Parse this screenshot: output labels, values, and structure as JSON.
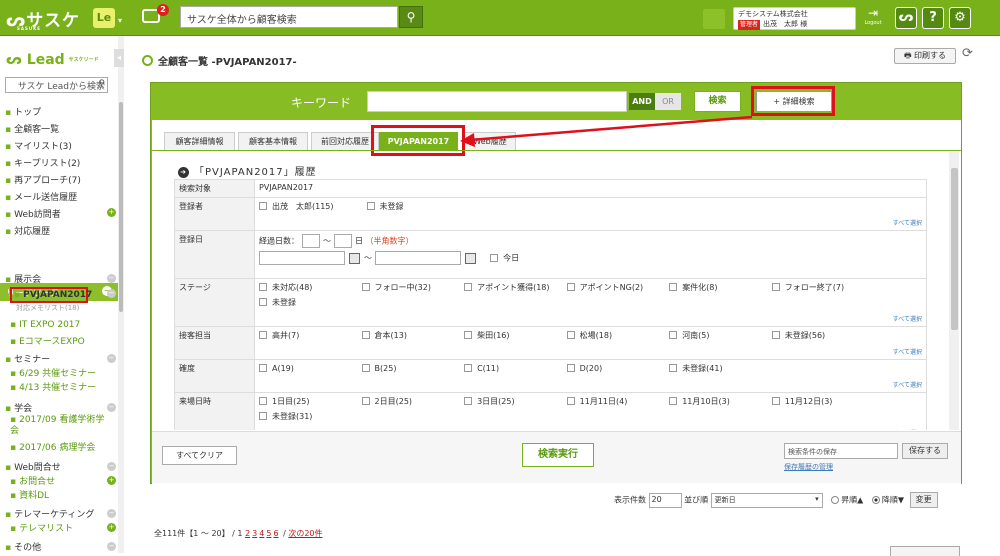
{
  "header": {
    "logo": "ᔕサスケ",
    "logo_sub": "SASUKE",
    "le": "Le",
    "notification_count": "2",
    "search_placeholder": "サスケ全体から顧客検索",
    "company": "デモシステム株式会社",
    "role": "管理者",
    "user": "出茂　太郎 様",
    "logout": "Logout"
  },
  "sidebar": {
    "logo": "ᔕ Lead",
    "logo_sub": "サスケリード",
    "search_placeholder": "サスケ Leadから検索",
    "nav": [
      "トップ",
      "全顧客一覧",
      "マイリスト(3)",
      "キープリスト(2)",
      "再アプローチ(7)",
      "メール送信履歴",
      "Web訪問者",
      "対応履歴"
    ],
    "section_title": "リードソース",
    "sources": {
      "exhibition": "展示会",
      "pvjapan": "PVJAPAN2017",
      "pv_sub": "対応メモリスト(18)",
      "itexpo": "IT EXPO 2017",
      "ecom": "EコマースEXPO",
      "seminar": "セミナー",
      "sem1": "6/29 共催セミナー",
      "sem2": "4/13 共催セミナー",
      "academic": "学会",
      "ac1": "2017/09 看護学術学会",
      "ac2": "2017/06 病理学会",
      "web": "Web問合せ",
      "web1": "お問合せ",
      "web2": "資料DL",
      "tele": "テレマーケティング",
      "tele1": "テレマリスト",
      "other": "その他"
    }
  },
  "page": {
    "title": "全顧客一覧 -PVJAPAN2017-",
    "print": "印刷する"
  },
  "search": {
    "keyword_label": "キーワード",
    "and": "AND",
    "or": "OR",
    "search_btn": "検索",
    "detail_btn": "+ 詳細検索"
  },
  "tabs": [
    "顧客詳細情報",
    "顧客基本情報",
    "前回対応履歴",
    "PVJAPAN2017",
    "Web履歴"
  ],
  "history_title": "「PVJAPAN2017」履歴",
  "filter": {
    "target_label": "検索対象",
    "target_value": "PVJAPAN2017",
    "registrant_label": "登録者",
    "registrant_opts": [
      "出茂　太郎(115)",
      "未登録"
    ],
    "regdate_label": "登録日",
    "elapsed_label": "経過日数：",
    "tilde": "〜",
    "day": "日",
    "hint": "（半角数字）",
    "today": "今日",
    "stage_label": "ステージ",
    "stage_opts": [
      "未対応(48)",
      "フォロー中(32)",
      "アポイント獲得(18)",
      "アポイントNG(2)",
      "案件化(8)",
      "フォロー終了(7)",
      "未登録"
    ],
    "staff_label": "接客担当",
    "staff_opts": [
      "高井(7)",
      "倉本(13)",
      "柴田(16)",
      "松場(18)",
      "河南(5)",
      "未登録(56)"
    ],
    "cert_label": "確度",
    "cert_opts": [
      "A(19)",
      "B(25)",
      "C(11)",
      "D(20)",
      "未登録(41)"
    ],
    "visit_label": "来場日時",
    "visit_opts": [
      "1日目(25)",
      "2日目(25)",
      "3日目(25)",
      "11月11日(4)",
      "11月10日(3)",
      "11月12日(3)",
      "未登録(31)"
    ],
    "select_all": "すべて選択"
  },
  "bottom": {
    "clear": "すべてクリア",
    "exec": "検索実行",
    "save_placeholder": "検索条件の保存",
    "save_btn": "保存する",
    "save_link": "保存履歴の管理"
  },
  "list_controls": {
    "count_label": "表示件数",
    "count": "20",
    "sort_label": "並び順",
    "sort_value": "更新日",
    "asc": "昇順▲",
    "desc": "降順▼",
    "change": "変更"
  },
  "pager": {
    "summary": "全111件【1 〜 20】 /",
    "current": "1",
    "pages": [
      "2",
      "3",
      "4",
      "5",
      "6"
    ],
    "sep": "/",
    "next": "次の20件"
  }
}
